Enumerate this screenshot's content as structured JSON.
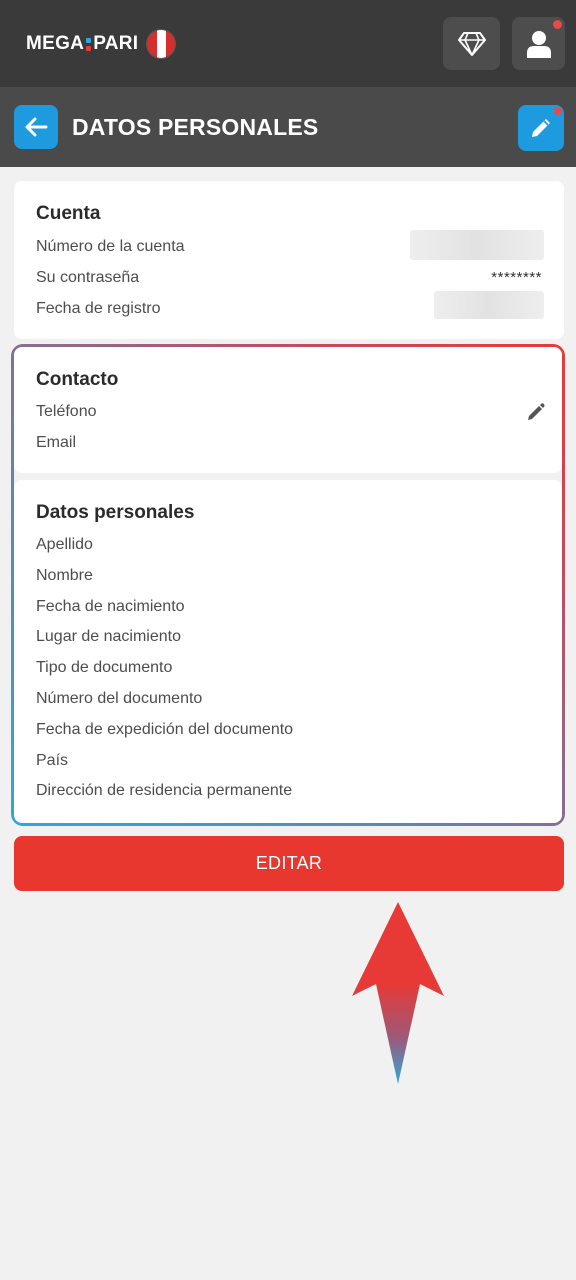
{
  "brand": {
    "logo_left": "MEGA",
    "logo_right": "PARI",
    "colon_colors": [
      "#2ea8db",
      "#e73a36"
    ],
    "flag_colors": [
      "#d62d2d",
      "#ffffff",
      "#d62d2d"
    ]
  },
  "topbar": {
    "icons": [
      "diamond-icon",
      "user-icon"
    ]
  },
  "header": {
    "title": "DATOS PERSONALES",
    "back_icon": "arrow-left-icon",
    "edit_icon": "pencil-icon"
  },
  "cuenta": {
    "title": "Cuenta",
    "rows": [
      {
        "label": "Número de la cuenta"
      },
      {
        "label": "Su contraseña",
        "value": "********"
      },
      {
        "label": "Fecha de registro"
      }
    ]
  },
  "contacto": {
    "title": "Contacto",
    "rows": [
      {
        "label": "Teléfono"
      },
      {
        "label": "Email"
      }
    ]
  },
  "datos": {
    "title": "Datos personales",
    "rows": [
      {
        "label": "Apellido"
      },
      {
        "label": "Nombre"
      },
      {
        "label": "Fecha de nacimiento"
      },
      {
        "label": "Lugar de nacimiento"
      },
      {
        "label": "Tipo de documento"
      },
      {
        "label": "Número del documento"
      },
      {
        "label": "Fecha de expedición del documento"
      },
      {
        "label": "País"
      },
      {
        "label": "Dirección de residencia permanente"
      }
    ]
  },
  "actions": {
    "edit_label": "EDITAR"
  },
  "colors": {
    "accent_blue": "#1e9ade",
    "accent_red": "#e8372f",
    "topbar": "#3a3a3a",
    "header": "#4a4a4a"
  }
}
